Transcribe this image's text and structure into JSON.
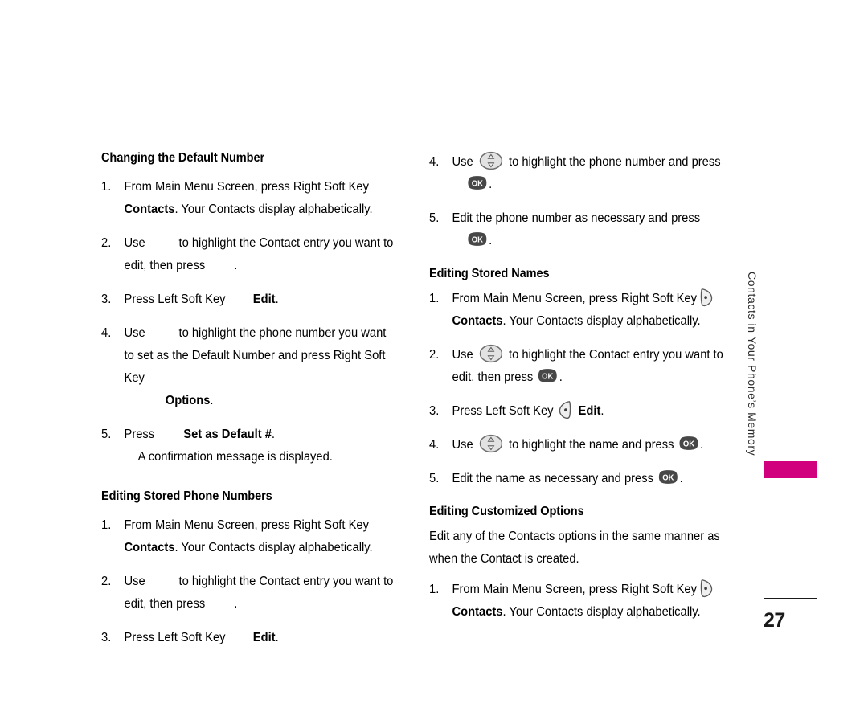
{
  "page": {
    "number": "27",
    "running_head": "Contacts in Your Phone’s Memory",
    "tab_color": "#d1007d"
  },
  "left_column": {
    "section1": {
      "heading": "Changing the Default Number",
      "steps": [
        {
          "num": "1.",
          "pre": "From Main Menu Screen, press Right Soft Key",
          "icon": "none",
          "bold": "Contacts",
          "post": ". Your Contacts display alphabetically."
        },
        {
          "num": "2.",
          "pre": "Use",
          "icon": "nav-key-missing",
          "post": "to highlight the Contact entry you want to edit, then press",
          "icon2": "ok-key-missing",
          "tail": "."
        },
        {
          "num": "3.",
          "pre": "Press Left Soft Key",
          "icon": "left-soft-key-missing",
          "bold": "Edit",
          "post": "."
        },
        {
          "num": "4.",
          "pre": "Use",
          "icon": "nav-key-missing",
          "post": "to highlight the phone number you want to set as the Default Number and press Right Soft Key",
          "icon2": "right-soft-key-missing",
          "bold": "Options",
          "tail": "."
        },
        {
          "num": "5.",
          "pre": "Press",
          "icon": "ok-key-missing",
          "bold": "Set as Default #",
          "post": ".",
          "note": "A confirmation message is displayed."
        }
      ]
    },
    "section2": {
      "heading": "Editing Stored Phone Numbers",
      "steps": [
        {
          "num": "1.",
          "pre": "From Main Menu Screen, press Right Soft Key",
          "icon": "none",
          "bold": "Contacts",
          "post": ". Your Contacts display alphabetically."
        },
        {
          "num": "2.",
          "pre": "Use",
          "icon": "nav-key-missing",
          "post": "to highlight the Contact entry you want to edit, then press",
          "icon2": "ok-key-missing",
          "tail": "."
        },
        {
          "num": "3.",
          "pre": "Press Left Soft Key",
          "icon": "left-soft-key-missing",
          "bold": "Edit",
          "post": "."
        }
      ]
    }
  },
  "right_column": {
    "continued": {
      "steps": [
        {
          "num": "4.",
          "pre": "Use",
          "icon": "nav-key",
          "post": "to highlight the phone number and press",
          "icon2": "ok-key",
          "tail": "."
        },
        {
          "num": "5.",
          "pre": "Edit the phone number as necessary and press",
          "icon": "ok-key",
          "tail": "."
        }
      ]
    },
    "section3": {
      "heading": "Editing Stored Names",
      "steps": [
        {
          "num": "1.",
          "pre": "From Main Menu Screen, press Right Soft Key",
          "icon": "right-soft-key",
          "bold": "Contacts",
          "post": ". Your Contacts display alphabetically."
        },
        {
          "num": "2.",
          "pre": "Use",
          "icon": "nav-key",
          "post": "to highlight the Contact entry you want to edit, then press",
          "icon2": "ok-key",
          "tail": "."
        },
        {
          "num": "3.",
          "pre": "Press Left Soft Key",
          "icon": "left-soft-key",
          "bold": "Edit",
          "post": "."
        },
        {
          "num": "4.",
          "pre": "Use",
          "icon": "nav-key",
          "post": "to highlight the name and press",
          "icon2": "ok-key",
          "tail": "."
        },
        {
          "num": "5.",
          "pre": "Edit the name as necessary and press",
          "icon": "ok-key",
          "tail": "."
        }
      ]
    },
    "section4": {
      "heading": "Editing Customized Options",
      "intro": "Edit any of the Contacts options in the same manner as when the Contact is created.",
      "steps": [
        {
          "num": "1.",
          "pre": "From Main Menu Screen, press Right Soft Key",
          "icon": "right-soft-key",
          "bold": "Contacts",
          "post": ". Your Contacts display alphabetically."
        }
      ]
    }
  },
  "icons": {
    "nav_key": "navigation-key",
    "ok_key_label": "OK",
    "left_soft_key": "left-soft-key",
    "right_soft_key": "right-soft-key"
  }
}
